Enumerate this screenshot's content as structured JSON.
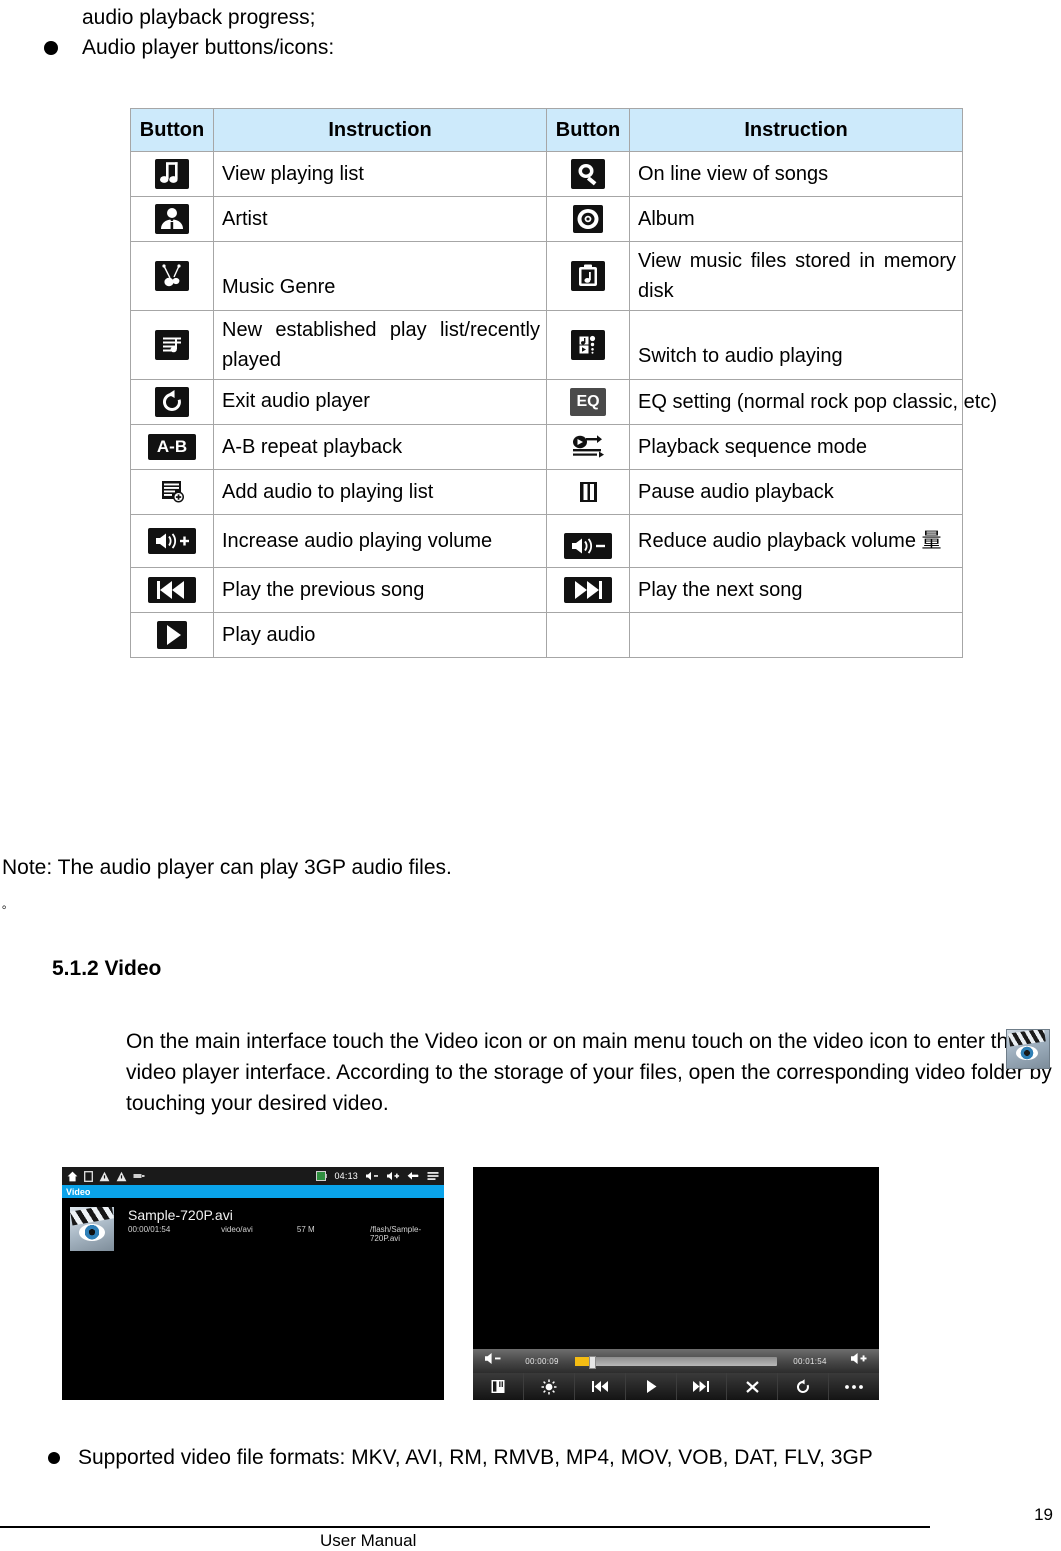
{
  "intro": {
    "line1": "audio playback progress;",
    "bullet_text": "Audio player buttons/icons:"
  },
  "icon_table": {
    "headers": [
      "Button",
      "Instruction",
      "Button",
      "Instruction"
    ],
    "rows": [
      {
        "left_icon": "music-note-playlist-icon",
        "left_text": "View playing list",
        "right_icon": "magnifier-search-icon",
        "right_text": "On line view of songs"
      },
      {
        "left_icon": "artist-person-icon",
        "left_text": "Artist",
        "right_icon": "album-disc-icon",
        "right_text": "Album"
      },
      {
        "left_icon": "guitar-genre-icon",
        "left_text": "Music Genre",
        "right_icon": "music-folder-icon",
        "right_text": "View music files stored in memory disk"
      },
      {
        "left_icon": "new-playlist-icon",
        "left_text": "New established play list/recently played",
        "right_icon": "switch-audio-icon",
        "right_text": "Switch to audio playing"
      },
      {
        "left_icon": "exit-return-icon",
        "left_text": "Exit audio player",
        "right_icon": "eq-setting-icon",
        "right_text": "EQ setting (normal rock pop classic, etc)"
      },
      {
        "left_icon": "a-b-repeat-icon",
        "left_text": "A-B repeat playback",
        "right_icon": "playback-sequence-icon",
        "right_text": "Playback sequence mode"
      },
      {
        "left_icon": "add-to-playlist-icon",
        "left_text": "Add audio to playing list",
        "right_icon": "pause-icon",
        "right_text": "Pause audio playback"
      },
      {
        "left_icon": "volume-up-icon",
        "left_text": "Increase audio playing volume",
        "right_icon": "volume-down-icon",
        "right_text": "Reduce audio playback volume 量"
      },
      {
        "left_icon": "previous-track-icon",
        "left_text": "Play the previous song",
        "right_icon": "next-track-icon",
        "right_text": "Play the next song"
      },
      {
        "left_icon": "play-icon",
        "left_text": "Play audio",
        "right_icon": "",
        "right_text": ""
      }
    ],
    "header_bg": "#cdeafb",
    "border_color": "#a6a6a6",
    "ab_label": "A-B",
    "eq_label": "EQ"
  },
  "note": "Note: The audio player can play 3GP audio files.",
  "stray_mark": "。",
  "section": {
    "heading": "5.1.2 Video",
    "paragraph": "On the main interface touch the Video icon or on main menu touch on the video icon to enter the video player interface. According to the storage of your files, open the corresponding video folder by touching your desired video."
  },
  "screenshot_left": {
    "status_time": "04:13",
    "title": "Video",
    "file_name": "Sample-720P.avi",
    "duration": "00:00/01:54",
    "mime": "video/avi",
    "size": "57 M",
    "path": "/flash/Sample-720P.avi",
    "title_bar_color": "#0aa3ea"
  },
  "screenshot_right": {
    "current_time": "00:00:09",
    "total_time": "00:01:54",
    "progress_percent": 7,
    "progress_color": "#f5bd13",
    "toolbar_icons": [
      "bookmark-icon",
      "brightness-icon",
      "previous-track-icon",
      "play-icon",
      "next-track-icon",
      "close-icon",
      "rotate-icon",
      "more-options-icon"
    ]
  },
  "bottom_bullet": "Supported video file formats: MKV, AVI, RM, RMVB, MP4, MOV, VOB, DAT, FLV, 3GP",
  "footer": {
    "label": "User Manual",
    "page": "19"
  }
}
